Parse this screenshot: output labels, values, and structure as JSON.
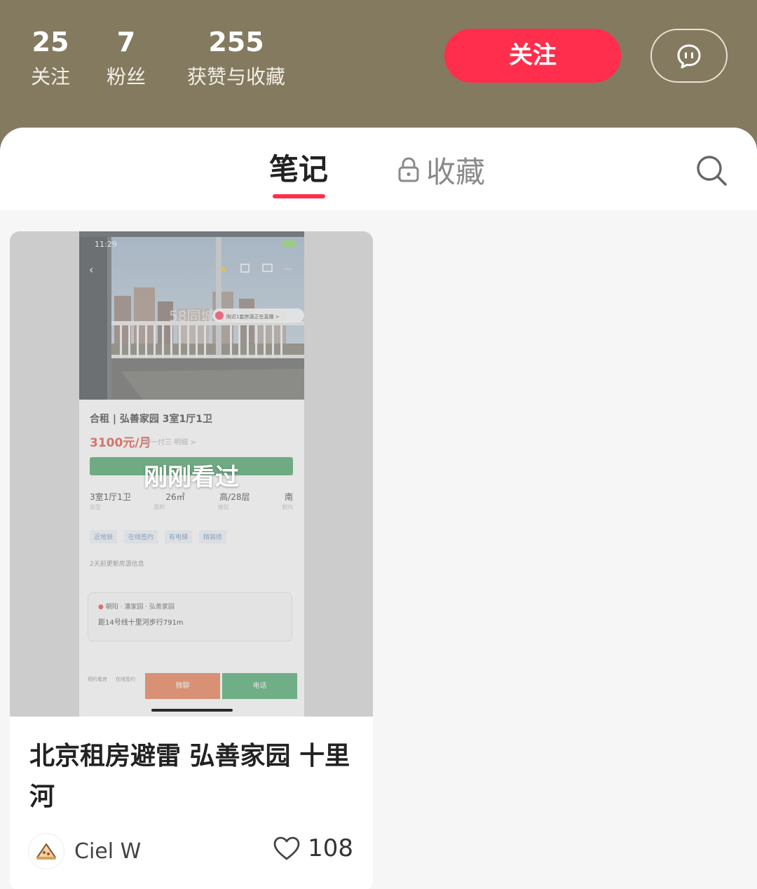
{
  "profile": {
    "stats": [
      {
        "value": "25",
        "label": "关注"
      },
      {
        "value": "7",
        "label": "粉丝"
      },
      {
        "value": "255",
        "label": "获赞与收藏"
      }
    ],
    "follow_label": "关注"
  },
  "tabs": {
    "notes_label": "笔记",
    "favorites_label": "收藏"
  },
  "note": {
    "cover_overlay": "刚刚看过",
    "title": "北京租房避雷 弘善家园 十里河",
    "author": "Ciel W",
    "likes": "108",
    "screenshot": {
      "status_time": "11:29",
      "listing_title": "合租 | 弘善家园 3室1厅1卫",
      "price": "3100元/月",
      "payment": "押一付三 明细 >",
      "specs": [
        "3室1厅1卫",
        "26㎡",
        "高/28层",
        "南"
      ],
      "spec_subs": [
        "房型",
        "面积",
        "楼层",
        "朝向"
      ],
      "tags": [
        "近地铁",
        "在线签约",
        "有电梯",
        "精装修"
      ],
      "update_text": "2天前更新房源信息",
      "location": "朝阳 · 潘家园 · 弘善家园",
      "distance": "距14号线十里河步行791m",
      "live_banner": "附近1套房源正在直播 >",
      "watermark": "58同城",
      "btn_chat": "微聊",
      "btn_call": "电话",
      "bottom_left_1": "预约看房",
      "bottom_left_2": "在线签约"
    }
  },
  "colors": {
    "header_bg": "#847a60",
    "accent": "#ff2e4d",
    "listing_green": "#3f9e60",
    "listing_orange": "#e8774a"
  },
  "icons": {
    "chat": "chat-bubble-icon",
    "lock": "lock-icon",
    "search": "search-icon",
    "heart": "heart-icon"
  }
}
